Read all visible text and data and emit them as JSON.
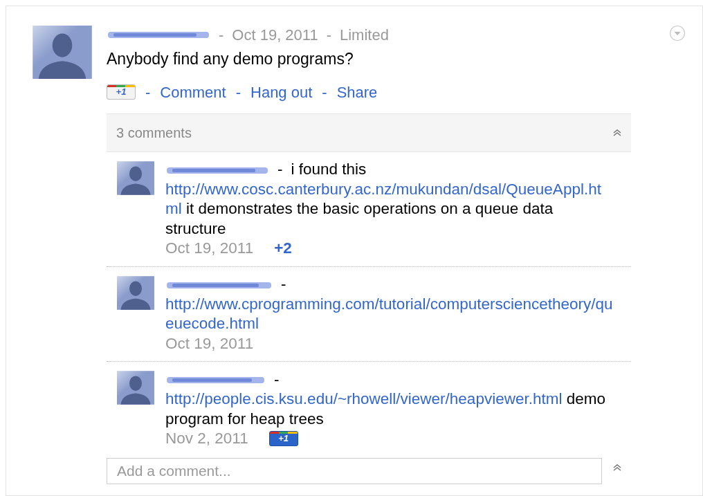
{
  "post": {
    "header_separators": [
      "-",
      "-"
    ],
    "date": "Oct 19, 2011",
    "visibility": "Limited",
    "text": "Anybody find any demo programs?",
    "plus_one": {
      "label": "+1",
      "selected": false
    },
    "actions": [
      {
        "separator": "-",
        "label": "Comment"
      },
      {
        "separator": "-",
        "label": "Hang out"
      },
      {
        "separator": "-",
        "label": "Share"
      }
    ]
  },
  "comments_header": {
    "count": "3 comments"
  },
  "comments": [
    {
      "separator": "-",
      "intro": "i found this",
      "link": "http://www.cosc.canterbury.ac.nz/mukundan/dsal/QueueAppl.html",
      "after": " it demonstrates the basic operations on a queue data structure",
      "date": "Oct 19, 2011",
      "plus_one": {
        "kind": "count",
        "label": "+2"
      }
    },
    {
      "separator": "-",
      "link": "http://www.cprogramming.com/tutorial/computersciencetheory/queuecode.html",
      "date": "Oct 19, 2011"
    },
    {
      "separator": "-",
      "link": "http://people.cis.ksu.edu/~rhowell/viewer/heapviewer.html",
      "after": " demo program for heap trees",
      "date": "Nov 2, 2011",
      "plus_one": {
        "kind": "button",
        "label": "+1",
        "selected": true
      }
    }
  ],
  "add_comment": {
    "placeholder": "Add a comment..."
  }
}
